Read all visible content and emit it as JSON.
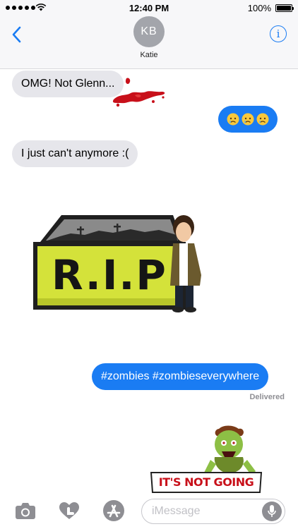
{
  "status_bar": {
    "time": "12:40 PM",
    "battery_percent": "100%",
    "signal_icon": "signal-dots-icon",
    "wifi_icon": "wifi-icon",
    "battery_icon": "battery-icon",
    "battery_level": 1.0
  },
  "header": {
    "avatar_initials": "KB",
    "contact_name": "Katie",
    "back_icon": "chevron-left-icon",
    "info_icon": "info-icon",
    "info_symbol": "i"
  },
  "messages": [
    {
      "direction": "incoming",
      "text": "OMG! Not Glenn..."
    },
    {
      "direction": "outgoing",
      "emoji": [
        "😢",
        "😢",
        "😢"
      ]
    },
    {
      "direction": "incoming",
      "text": "I just can't anymore :("
    },
    {
      "direction": "sticker",
      "sticker_text": "R.I.P"
    },
    {
      "direction": "outgoing",
      "text": "#zombies #zombieseverywhere"
    }
  ],
  "delivery_status": "Delivered",
  "stickers": {
    "blood_splatter": "blood-splatter-sticker",
    "rip_text": "R.I.P",
    "zombie_banner": "IT'S NOT GOING"
  },
  "input_bar": {
    "placeholder": "iMessage",
    "value": "",
    "camera_icon": "camera-icon",
    "digital_touch_icon": "heart-hand-icon",
    "app_store_icon": "app-store-icon",
    "mic_icon": "microphone-icon"
  },
  "colors": {
    "accent": "#1a7cf3",
    "incoming_bubble": "#e6e6eb",
    "header_bg": "#f7f7f9",
    "rip_sign": "#d4e23a",
    "blood": "#c8101a"
  }
}
